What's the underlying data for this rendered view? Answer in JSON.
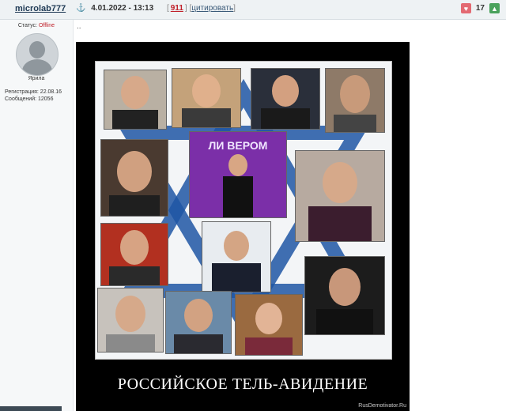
{
  "post": {
    "username": "microlab777",
    "anchor_icon": "anchor-icon",
    "date": "4.01.2022 - 13:13",
    "post_number": "911",
    "quote_label": "цитировать",
    "rating": "17"
  },
  "sidebar": {
    "status_label": "Статус:",
    "status_value": "Offline",
    "rank": "Ярила",
    "reg_line": "Регистрация: 22.08.16",
    "posts_line": "Сообщений: 12056"
  },
  "body_text": "..",
  "poster": {
    "caption": "РОССИЙСКОЕ ТЕЛЬ-АВИДЕНИЕ",
    "watermark": "RusDemotivator.Ru",
    "sign_text": "ЛИ ВЕРОМ"
  },
  "colors": {
    "accent_red": "#c0202a",
    "header_bg": "#eef2f4"
  }
}
